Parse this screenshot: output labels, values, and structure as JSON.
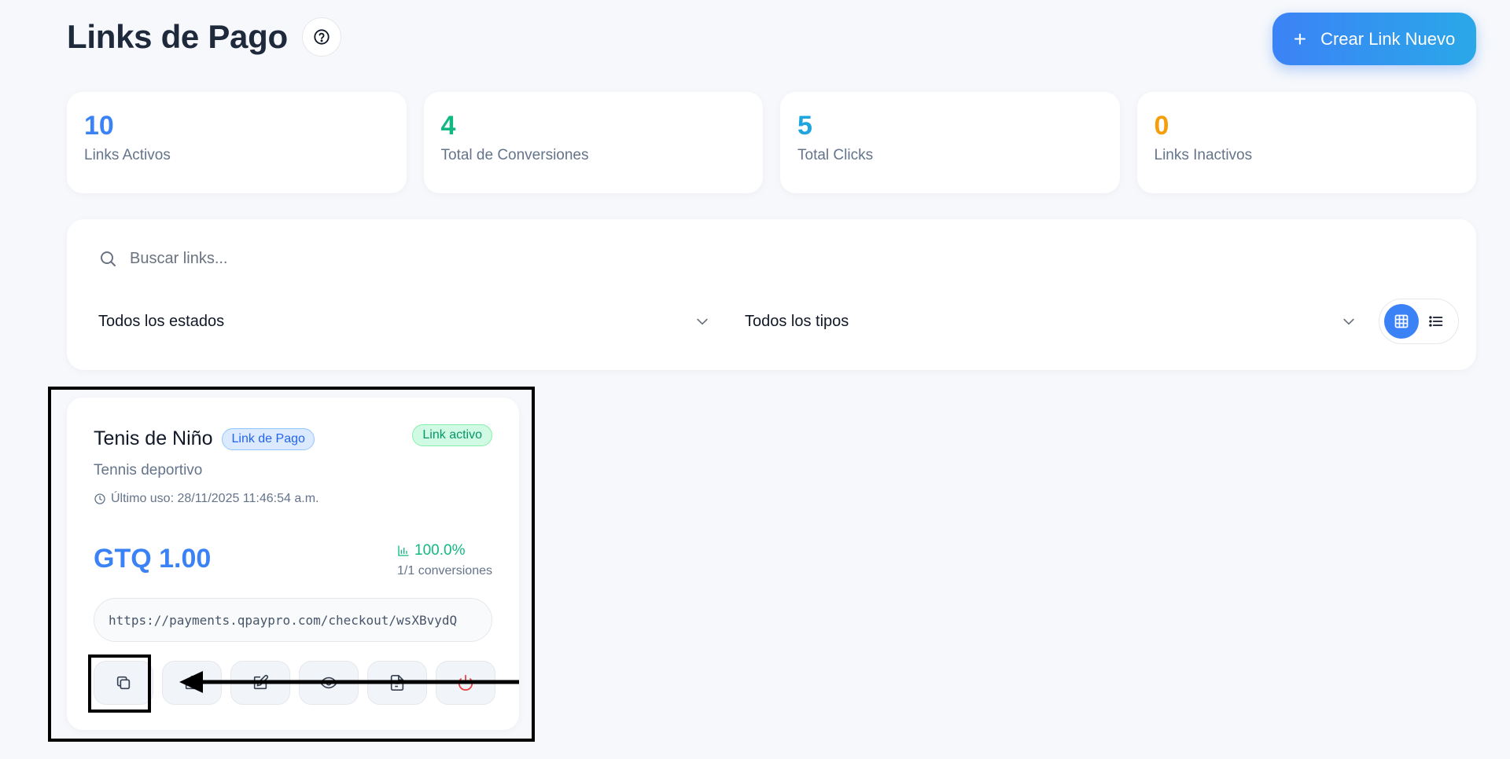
{
  "header": {
    "title": "Links de Pago",
    "create_button_label": "Crear Link Nuevo"
  },
  "stats": [
    {
      "value": "10",
      "label": "Links Activos",
      "color": "#3b82f6"
    },
    {
      "value": "4",
      "label": "Total de Conversiones",
      "color": "#10b981"
    },
    {
      "value": "5",
      "label": "Total Clicks",
      "color": "#1ea5e0"
    },
    {
      "value": "0",
      "label": "Links Inactivos",
      "color": "#f59e0b"
    }
  ],
  "filters": {
    "search_placeholder": "Buscar links...",
    "status_select": "Todos los estados",
    "type_select": "Todos los tipos",
    "active_view": "grid"
  },
  "link_card": {
    "title": "Tenis de Niño",
    "type_badge": "Link de Pago",
    "status_badge": "Link activo",
    "description": "Tennis deportivo",
    "last_use": "Último uso: 28/11/2025 11:46:54 a.m.",
    "price": "GTQ 1.00",
    "conversion_rate": "100.0%",
    "conversions": "1/1 conversiones",
    "url": "https://payments.qpaypro.com/checkout/wsXBvydQ",
    "actions": [
      "copy-icon",
      "share-icon",
      "edit-icon",
      "view-icon",
      "document-icon",
      "power-icon"
    ]
  }
}
